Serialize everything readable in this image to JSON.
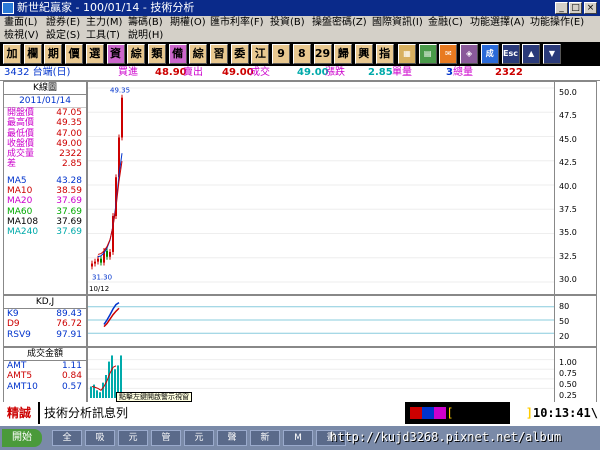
{
  "window": {
    "title": "新世紀贏家 - 100/01/14 - 技術分析"
  },
  "menu": {
    "row1": [
      "畫面(L)",
      "證券(E)",
      "主力(M)",
      "籌碼(B)",
      "期權(O)",
      "匯市利率(F)",
      "投資(B)",
      "操盤密碼(Z)",
      "國際資訊(I)",
      "金融(C)",
      "功能選擇(A)",
      "功能操作(E)"
    ],
    "row2": [
      "檢視(V)",
      "設定(S)",
      "工具(T)",
      "說明(H)"
    ]
  },
  "toolbar": {
    "buttons": [
      "加",
      "欄",
      "期",
      "價",
      "選",
      "資",
      "綜",
      "類",
      "備",
      "綜",
      "習",
      "委",
      "江",
      "9",
      "8",
      "29",
      "歸",
      "興",
      "指"
    ],
    "icon_buttons": [
      "chart-icon",
      "grid-icon",
      "news-icon",
      "stock-icon",
      "trade-icon",
      "exit-icon",
      "page-up-icon",
      "page-down-icon"
    ]
  },
  "quote": {
    "code_name": "3432 台端(日)",
    "buy_label": "買進",
    "buy_value": "48.90",
    "sell_label": "賣出",
    "sell_value": "49.00",
    "deal_label": "成交",
    "deal_value": "49.00",
    "change_label": "漲跌",
    "change_value": "2.85",
    "vol_label": "單量",
    "vol_value": "3",
    "total_label": "總量",
    "total_value": "2322"
  },
  "kline_panel": {
    "header": "K線圖",
    "date": "2011/01/14",
    "rows": [
      {
        "k": "開盤價",
        "v": "47.05"
      },
      {
        "k": "最高價",
        "v": "49.35"
      },
      {
        "k": "最低價",
        "v": "47.00"
      },
      {
        "k": "收盤價",
        "v": "49.00"
      },
      {
        "k": "成交量",
        "v": "2322"
      },
      {
        "k": "差",
        "v": "2.85"
      }
    ],
    "ma": [
      {
        "k": "MA5",
        "v": "43.28",
        "c": "#0033cc"
      },
      {
        "k": "MA10",
        "v": "38.59",
        "c": "#cc0000"
      },
      {
        "k": "MA20",
        "v": "37.69",
        "c": "#cc00cc"
      },
      {
        "k": "MA60",
        "v": "37.69",
        "c": "#00aa00"
      },
      {
        "k": "MA108",
        "v": "37.69",
        "c": "#000000"
      },
      {
        "k": "MA240",
        "v": "37.69",
        "c": "#00aaaa"
      }
    ]
  },
  "kd_panel": {
    "header": "KD,J",
    "rows": [
      {
        "k": "K9",
        "v": "89.43",
        "c": "#0033cc"
      },
      {
        "k": "D9",
        "v": "76.72",
        "c": "#cc0000"
      },
      {
        "k": "RSV9",
        "v": "97.91",
        "c": "#0033cc"
      }
    ]
  },
  "amt_panel": {
    "header": "成交金額",
    "rows": [
      {
        "k": "AMT",
        "v": "1.11",
        "c": "#0033cc"
      },
      {
        "k": "AMT5",
        "v": "0.84",
        "c": "#cc0000"
      },
      {
        "k": "AMT10",
        "v": "0.57",
        "c": "#0033cc"
      }
    ],
    "tooltip": "點擊左鍵開啟警示視窗"
  },
  "axes": {
    "price_ticks": [
      "50.0",
      "47.5",
      "45.0",
      "42.5",
      "40.0",
      "37.5",
      "35.0",
      "32.5",
      "30.0"
    ],
    "kd_ticks": [
      "80",
      "50",
      "20"
    ],
    "amt_ticks": [
      "1.00",
      "0.75",
      "0.50",
      "0.25"
    ],
    "high_label": "49.35",
    "low_label": "31.30",
    "date_label": "10/12"
  },
  "chart_data": {
    "type": "line",
    "title": "",
    "candles_close": [
      31.9,
      32.1,
      32.4,
      32.0,
      33.2,
      32.6,
      33.1,
      36.8,
      40.8,
      44.9,
      49.0
    ],
    "ma5": [
      32.6,
      32.7,
      33.0,
      33.5,
      34.3,
      35.8,
      38.0,
      41.0,
      43.28
    ],
    "kd_k": [
      40,
      50,
      62,
      75,
      85,
      89.43
    ],
    "kd_d": [
      35,
      42,
      52,
      62,
      70,
      76.72
    ],
    "amt": [
      0.3,
      0.35,
      0.2,
      0.15,
      0.4,
      0.6,
      0.95,
      1.11,
      0.75,
      0.85,
      1.11
    ]
  },
  "status": {
    "left_label": "精誠",
    "message": "技術分析訊息列",
    "time": "10:13:41",
    "colors": [
      "#cc0000",
      "#0033cc",
      "#cc00cc"
    ]
  },
  "taskbar": {
    "start": "開始",
    "items": [
      "全",
      "吸",
      "元",
      "管",
      "元",
      "聲",
      "新",
      "M",
      "畫"
    ],
    "url": "http://kujd3268.pixnet.net/album"
  }
}
